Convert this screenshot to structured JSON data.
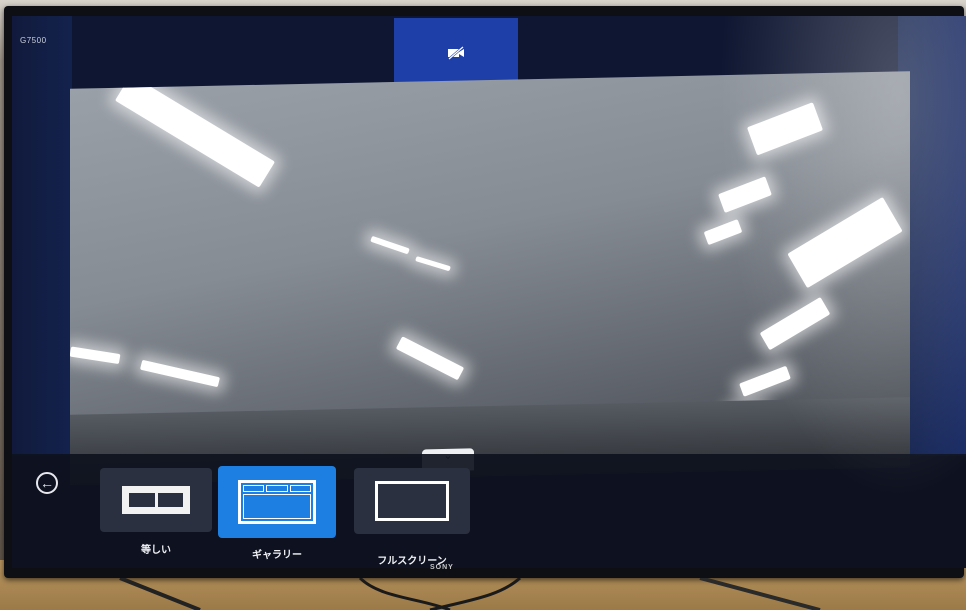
{
  "screen": {
    "device_label": "G7500",
    "mute_icon": "camera-off-icon",
    "back_icon": "back-arrow-icon"
  },
  "layout_options": [
    {
      "label": "等しい",
      "icon": "equal-split-icon",
      "selected": false
    },
    {
      "label": "ギャラリー",
      "icon": "gallery-layout-icon",
      "selected": true
    },
    {
      "label": "フルスクリーン",
      "icon": "fullscreen-layout-icon",
      "selected": false
    }
  ],
  "camera_handle_icon": "chevron-down-icon",
  "tv": {
    "brand": "SONY"
  },
  "colors": {
    "accent_selected": "#1e7fe3",
    "mute_tile": "#1f3fa8",
    "panel_bg": "#0e121e"
  }
}
